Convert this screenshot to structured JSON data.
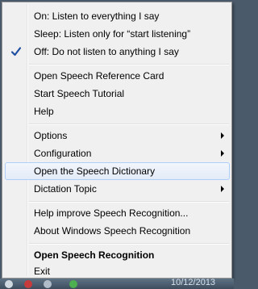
{
  "menu": {
    "items": [
      {
        "label": "On: Listen to everything I say"
      },
      {
        "label": "Sleep: Listen only for “start listening”"
      },
      {
        "label": "Off: Do not listen to anything I say",
        "checked": true
      },
      {
        "label": "Open Speech Reference Card"
      },
      {
        "label": "Start Speech Tutorial"
      },
      {
        "label": "Help"
      },
      {
        "label": "Options",
        "submenu": true
      },
      {
        "label": "Configuration",
        "submenu": true
      },
      {
        "label": "Open the Speech Dictionary",
        "highlighted": true
      },
      {
        "label": "Dictation Topic",
        "submenu": true
      },
      {
        "label": "Help improve Speech Recognition..."
      },
      {
        "label": "About Windows Speech Recognition"
      },
      {
        "label": "Open Speech Recognition",
        "bold": true
      },
      {
        "label": "Exit"
      }
    ]
  },
  "taskbar": {
    "time": "10/12/2013",
    "icons": [
      "shield-icon",
      "microphone-icon",
      "network-icon",
      "volume-icon"
    ]
  },
  "colors": {
    "menu_bg": "#f0f0f0",
    "highlight_border": "#aecff7",
    "check": "#1f4fa0",
    "desktop": "#4a5a6a"
  }
}
